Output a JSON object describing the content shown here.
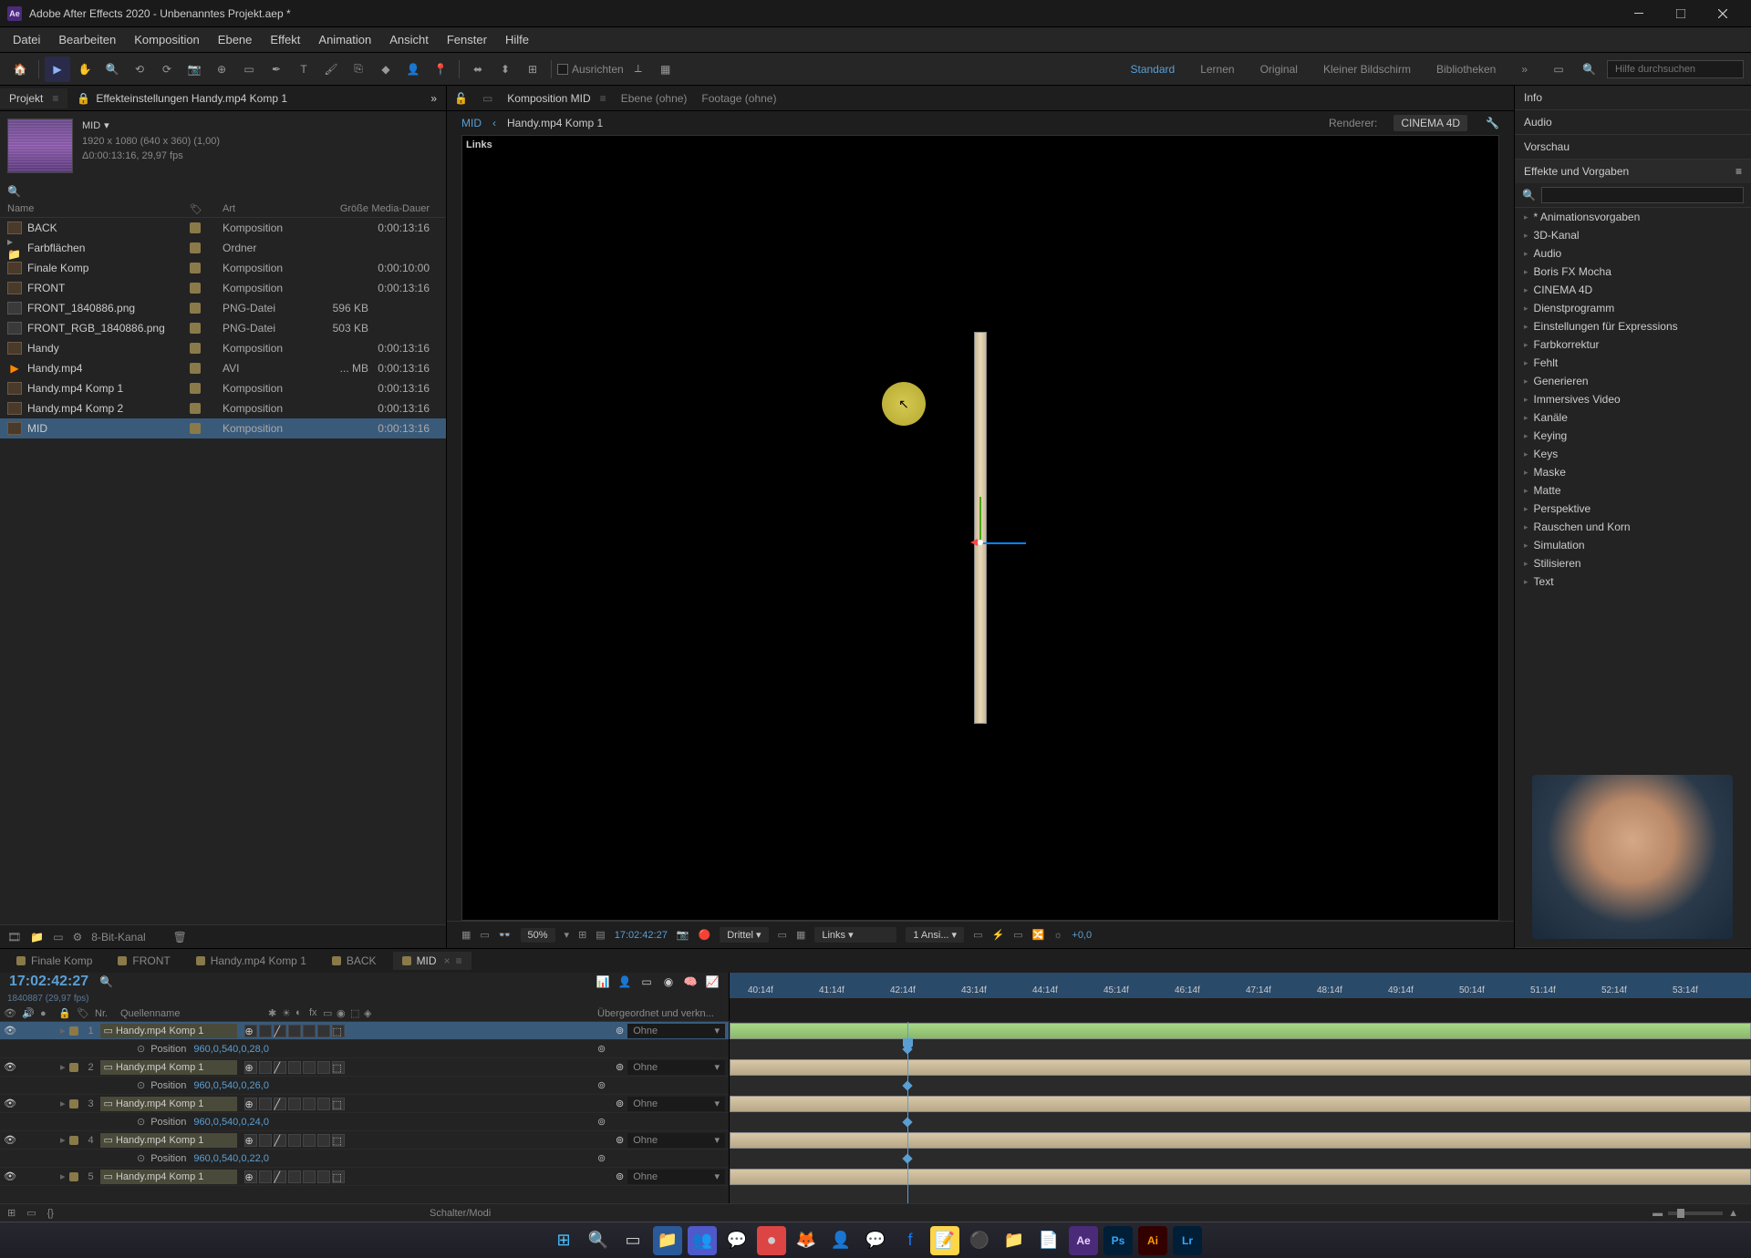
{
  "title": "Adobe After Effects 2020 - Unbenanntes Projekt.aep *",
  "menus": [
    "Datei",
    "Bearbeiten",
    "Komposition",
    "Ebene",
    "Effekt",
    "Animation",
    "Ansicht",
    "Fenster",
    "Hilfe"
  ],
  "align_label": "Ausrichten",
  "workspaces": [
    "Standard",
    "Lernen",
    "Original",
    "Kleiner Bildschirm",
    "Bibliotheken"
  ],
  "help_placeholder": "Hilfe durchsuchen",
  "project_tab": "Projekt",
  "effects_tab": "Effekteinstellungen Handy.mp4 Komp 1",
  "proj_info": {
    "name": "MID",
    "dims": "1920 x 1080 (640 x 360) (1,00)",
    "dur": "Δ0:00:13:16, 29,97 fps"
  },
  "proj_cols": {
    "name": "Name",
    "art": "Art",
    "size": "Größe",
    "dur": "Media-Dauer"
  },
  "proj_items": [
    {
      "icon": "comp",
      "name": "BACK",
      "art": "Komposition",
      "size": "",
      "dur": "0:00:13:16"
    },
    {
      "icon": "folder",
      "name": "Farbflächen",
      "art": "Ordner",
      "size": "",
      "dur": ""
    },
    {
      "icon": "comp",
      "name": "Finale Komp",
      "art": "Komposition",
      "size": "",
      "dur": "0:00:10:00"
    },
    {
      "icon": "comp",
      "name": "FRONT",
      "art": "Komposition",
      "size": "",
      "dur": "0:00:13:16"
    },
    {
      "icon": "file",
      "name": "FRONT_1840886.png",
      "art": "PNG-Datei",
      "size": "596 KB",
      "dur": ""
    },
    {
      "icon": "file",
      "name": "FRONT_RGB_1840886.png",
      "art": "PNG-Datei",
      "size": "503 KB",
      "dur": ""
    },
    {
      "icon": "comp",
      "name": "Handy",
      "art": "Komposition",
      "size": "",
      "dur": "0:00:13:16"
    },
    {
      "icon": "avi",
      "name": "Handy.mp4",
      "art": "AVI",
      "size": "... MB",
      "dur": "0:00:13:16"
    },
    {
      "icon": "comp",
      "name": "Handy.mp4 Komp 1",
      "art": "Komposition",
      "size": "",
      "dur": "0:00:13:16"
    },
    {
      "icon": "comp",
      "name": "Handy.mp4 Komp 2",
      "art": "Komposition",
      "size": "",
      "dur": "0:00:13:16"
    },
    {
      "icon": "comp",
      "name": "MID",
      "art": "Komposition",
      "size": "",
      "dur": "0:00:13:16",
      "selected": true
    }
  ],
  "proj_footer_bpc": "8-Bit-Kanal",
  "comp_tabs": {
    "comp": "Komposition MID",
    "layer": "Ebene  (ohne)",
    "footage": "Footage  (ohne)"
  },
  "breadcrumb": {
    "a": "MID",
    "b": "Handy.mp4 Komp 1"
  },
  "renderer_label": "Renderer:",
  "renderer_val": "CINEMA 4D",
  "viewport_label": "Links",
  "viewer_footer": {
    "zoom": "50%",
    "timecode": "17:02:42:27",
    "quality": "Drittel",
    "view": "Links",
    "views": "1 Ansi...",
    "exposure": "+0,0"
  },
  "right_panels": [
    "Info",
    "Audio",
    "Vorschau"
  ],
  "effects_head": "Effekte und Vorgaben",
  "effects_items": [
    "* Animationsvorgaben",
    "3D-Kanal",
    "Audio",
    "Boris FX Mocha",
    "CINEMA 4D",
    "Dienstprogramm",
    "Einstellungen für Expressions",
    "Farbkorrektur",
    "Fehlt",
    "Generieren",
    "Immersives Video",
    "Kanäle",
    "Keying",
    "Keys",
    "Maske",
    "Matte",
    "Perspektive",
    "Rauschen und Korn",
    "Simulation",
    "Stilisieren",
    "Text"
  ],
  "tl_tabs": [
    {
      "name": "Finale Komp"
    },
    {
      "name": "FRONT"
    },
    {
      "name": "Handy.mp4 Komp 1"
    },
    {
      "name": "BACK"
    },
    {
      "name": "MID",
      "active": true
    }
  ],
  "tl_timecode": "17:02:42:27",
  "tl_subtime": "1840887 (29,97 fps)",
  "tl_cols": {
    "num": "Nr.",
    "name": "Quellenname",
    "parent": "Übergeordnet und verkn..."
  },
  "tl_ticks": [
    "40:14f",
    "41:14f",
    "42:14f",
    "43:14f",
    "44:14f",
    "45:14f",
    "46:14f",
    "47:14f",
    "48:14f",
    "49:14f",
    "50:14f",
    "51:14f",
    "52:14f",
    "53:14f"
  ],
  "tl_layers": [
    {
      "num": 1,
      "name": "Handy.mp4 Komp 1",
      "parent": "Ohne",
      "selected": true,
      "props": [
        {
          "name": "Position",
          "val": "960,0,540,0,28,0"
        }
      ]
    },
    {
      "num": 2,
      "name": "Handy.mp4 Komp 1",
      "parent": "Ohne",
      "props": [
        {
          "name": "Position",
          "val": "960,0,540,0,26,0"
        }
      ]
    },
    {
      "num": 3,
      "name": "Handy.mp4 Komp 1",
      "parent": "Ohne",
      "props": [
        {
          "name": "Position",
          "val": "960,0,540,0,24,0"
        }
      ]
    },
    {
      "num": 4,
      "name": "Handy.mp4 Komp 1",
      "parent": "Ohne",
      "props": [
        {
          "name": "Position",
          "val": "960,0,540,0,22,0"
        }
      ]
    },
    {
      "num": 5,
      "name": "Handy.mp4 Komp 1",
      "parent": "Ohne"
    }
  ],
  "tl_footer": "Schalter/Modi"
}
